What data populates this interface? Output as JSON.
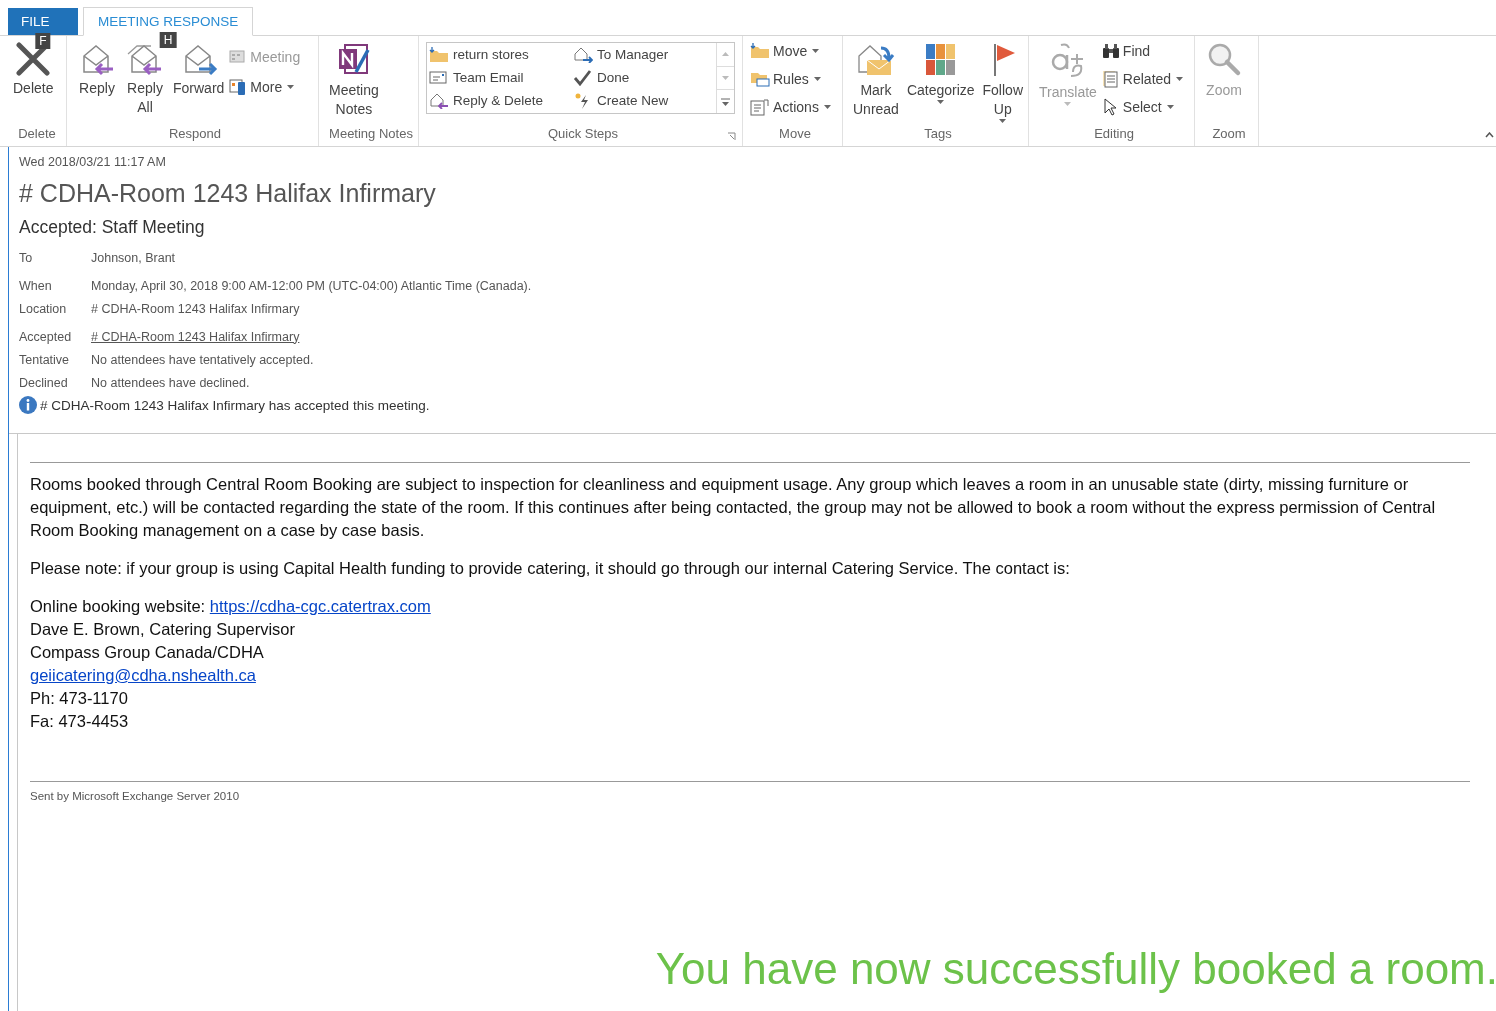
{
  "tabs": [
    {
      "label": "FILE",
      "selected": false,
      "key_tip": "F"
    },
    {
      "label": "MEETING RESPONSE",
      "selected": true,
      "key_tip": "H"
    }
  ],
  "ribbon": {
    "groups": [
      {
        "name": "Delete",
        "items": [
          {
            "label": "Delete",
            "kind": "large",
            "disabled": false
          }
        ]
      },
      {
        "name": "Respond",
        "items": [
          {
            "label": "Reply",
            "kind": "large",
            "disabled": false
          },
          {
            "label": "Reply All",
            "kind": "large",
            "disabled": false
          },
          {
            "label": "Forward",
            "kind": "large",
            "disabled": false
          },
          {
            "label": "Meeting",
            "kind": "small",
            "disabled": true,
            "menu": false
          },
          {
            "label": "More",
            "kind": "small",
            "disabled": false,
            "menu": true
          }
        ]
      },
      {
        "name": "Meeting Notes",
        "items": [
          {
            "label": "Meeting Notes",
            "kind": "large",
            "disabled": false
          }
        ]
      },
      {
        "name": "Quick Steps",
        "items": [
          {
            "label": "return stores",
            "kind": "step"
          },
          {
            "label": "Team Email",
            "kind": "step"
          },
          {
            "label": "Reply & Delete",
            "kind": "step"
          },
          {
            "label": "To Manager",
            "kind": "step"
          },
          {
            "label": "Done",
            "kind": "step"
          },
          {
            "label": "Create New",
            "kind": "step"
          }
        ]
      },
      {
        "name": "Move",
        "items": [
          {
            "label": "Move",
            "kind": "small",
            "disabled": false,
            "menu": true
          },
          {
            "label": "Rules",
            "kind": "small",
            "disabled": false,
            "menu": true
          },
          {
            "label": "Actions",
            "kind": "small",
            "disabled": false,
            "menu": true
          }
        ]
      },
      {
        "name": "Tags",
        "items": [
          {
            "label": "Mark Unread",
            "kind": "large",
            "disabled": false,
            "menu": false
          },
          {
            "label": "Categorize",
            "kind": "large",
            "disabled": false,
            "menu": true
          },
          {
            "label": "Follow Up",
            "kind": "large",
            "disabled": false,
            "menu": true
          }
        ]
      },
      {
        "name": "Editing",
        "items": [
          {
            "label": "Translate",
            "kind": "large",
            "disabled": true,
            "menu": true
          },
          {
            "label": "Find",
            "kind": "small",
            "disabled": false,
            "menu": false
          },
          {
            "label": "Related",
            "kind": "small",
            "disabled": false,
            "menu": true
          },
          {
            "label": "Select",
            "kind": "small",
            "disabled": false,
            "menu": true
          }
        ]
      },
      {
        "name": "Zoom",
        "items": [
          {
            "label": "Zoom",
            "disabled": true
          }
        ]
      }
    ]
  },
  "message": {
    "date": "Wed 2018/03/21 11:17 AM",
    "location_title": "# CDHA-Room 1243 Halifax Infirmary",
    "subject": "Accepted: Staff Meeting",
    "fields": [
      {
        "label": "To",
        "value": "Johnson, Brant",
        "kind": "text"
      },
      {
        "label": "When",
        "value": "Monday, April 30, 2018 9:00 AM-12:00 PM (UTC-04:00) Atlantic Time (Canada).",
        "kind": "text"
      },
      {
        "label": "Location",
        "value": "# CDHA-Room 1243 Halifax Infirmary",
        "kind": "text"
      },
      {
        "label": "Accepted",
        "value": "# CDHA-Room 1243 Halifax Infirmary",
        "kind": "link"
      },
      {
        "label": "Tentative",
        "value": "No attendees have tentatively accepted.",
        "kind": "text"
      },
      {
        "label": "Declined",
        "value": "No attendees have declined.",
        "kind": "text"
      }
    ],
    "info": "# CDHA-Room 1243 Halifax Infirmary has accepted this meeting."
  },
  "body": {
    "paragraphs": [
      "Rooms booked through Central Room Booking are subject to inspection for cleanliness and equipment usage. Any group which leaves a room in an unusable state (dirty, missing furniture or equipment, etc.) will be contacted regarding the state of the room. If this continues after being contacted, the group may not be allowed to book a room without the express permission of Central Room Booking management on a case by case basis.",
      "Please note: if your group is using Capital Health funding to provide catering, it should go through our internal Catering Service. The contact is:"
    ],
    "contact": [
      {
        "kind": "website",
        "text": "Online booking website: ",
        "link": "https://cdha-cgc.catertrax.com"
      },
      {
        "kind": "text",
        "text": "Dave E. Brown, Catering Supervisor"
      },
      {
        "kind": "text",
        "text": "Compass Group Canada/CDHA"
      },
      {
        "kind": "link",
        "text": "geiicatering@cdha.nshealth.ca"
      },
      {
        "kind": "text",
        "text": "Ph: 473-1170"
      },
      {
        "kind": "text",
        "text": "Fa: 473-4453"
      }
    ],
    "signature": "Sent by Microsoft Exchange Server 2010"
  },
  "caption": "You have now successfully booked a room."
}
